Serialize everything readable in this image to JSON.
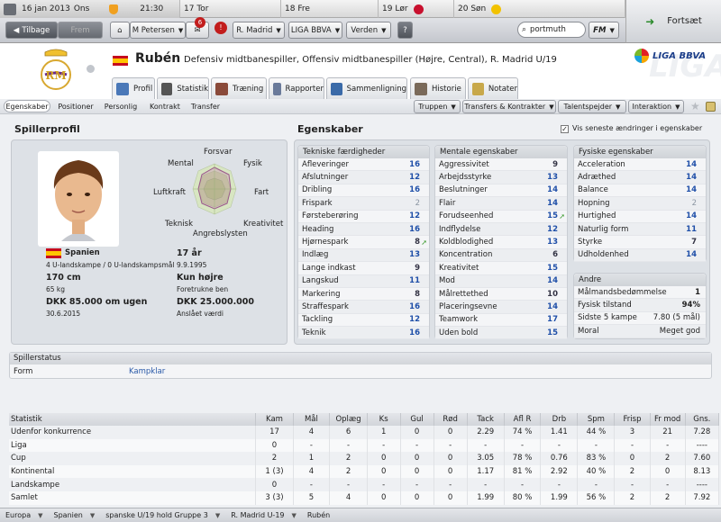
{
  "calendar": {
    "current_date": "16 jan 2013",
    "current_day": "Ons",
    "current_time": "21:30",
    "days": [
      {
        "label": "17 Tor",
        "color": ""
      },
      {
        "label": "18 Fre",
        "color": ""
      },
      {
        "label": "19 Lør",
        "color": "#c8102e"
      },
      {
        "label": "20 Søn",
        "color": "#f2c200"
      }
    ]
  },
  "nav": {
    "back": "Tilbage",
    "forward": "Frem",
    "manager": "M Petersen",
    "notif_count_a": "6",
    "notif_count_b": "!",
    "club": "R. Madrid",
    "league": "LIGA BBVA",
    "world": "Verden",
    "help": "?",
    "search_value": "portmuth",
    "fm_label": "FM",
    "continue": "Fortsæt"
  },
  "player": {
    "name": "Rubén",
    "description": "Defensiv midtbanespiller, Offensiv midtbanespiller (Højre, Central), R. Madrid U/19",
    "league_logo": "LIGA BBVA",
    "flag_colors": [
      "#c60b1e",
      "#ffc400"
    ]
  },
  "tabs": [
    {
      "label": "Profil",
      "icon": "profile-icon",
      "color": "#4a78b8"
    },
    {
      "label": "Statistik",
      "icon": "stats-icon",
      "color": "#555"
    },
    {
      "label": "Træning",
      "icon": "training-icon",
      "color": "#8a4a3a"
    },
    {
      "label": "Rapporter",
      "icon": "reports-icon",
      "color": "#6a7a9a"
    },
    {
      "label": "Sammenligning",
      "icon": "compare-icon",
      "color": "#3a6aa8"
    },
    {
      "label": "Historie",
      "icon": "history-icon",
      "color": "#7a6a5a"
    },
    {
      "label": "Notater",
      "icon": "notes-icon",
      "color": "#c8a84a"
    }
  ],
  "subtabs": [
    "Egenskaber",
    "Positioner",
    "Personlig",
    "Kontrakt",
    "Transfer"
  ],
  "actions": [
    "Truppen",
    "Transfers & Kontrakter",
    "Talentspejder",
    "Interaktion"
  ],
  "profile": {
    "title": "Spillerprofil",
    "radar_labels": {
      "top": "Forsvar",
      "top_left": "Mental",
      "top_right": "Fysik",
      "left": "Luftkraft",
      "right": "Fart",
      "bottom_left": "Teknisk",
      "bottom_right": "Kreativitet",
      "bottom": "Angrebslysten"
    },
    "nationality": "Spanien",
    "caps": "4 U-landskampe / 0 U-landskampsmål",
    "age": "17 år",
    "dob": "9.9.1995",
    "height": "170 cm",
    "weight": "65 kg",
    "foot": "Kun højre",
    "foot_label": "Foretrukne ben",
    "wage": "DKK 85.000 om ugen",
    "contract_end": "30.6.2015",
    "value": "DKK 25.000.000",
    "value_label": "Anslået værdi"
  },
  "attributes": {
    "title": "Egenskaber",
    "checkbox_label": "Vis seneste ændringer i egenskaber",
    "technical": {
      "title": "Tekniske færdigheder",
      "items": [
        {
          "name": "Afleveringer",
          "value": 16
        },
        {
          "name": "Afslutninger",
          "value": 12
        },
        {
          "name": "Dribling",
          "value": 16
        },
        {
          "name": "Frispark",
          "value": 2
        },
        {
          "name": "Førsteberøring",
          "value": 12
        },
        {
          "name": "Heading",
          "value": 16
        },
        {
          "name": "Hjørnespark",
          "value": 8,
          "mark": "up"
        },
        {
          "name": "Indlæg",
          "value": 13
        },
        {
          "name": "Lange indkast",
          "value": 9
        },
        {
          "name": "Langskud",
          "value": 11
        },
        {
          "name": "Markering",
          "value": 8
        },
        {
          "name": "Straffespark",
          "value": 16
        },
        {
          "name": "Tackling",
          "value": 12
        },
        {
          "name": "Teknik",
          "value": 16
        }
      ]
    },
    "mental": {
      "title": "Mentale egenskaber",
      "items": [
        {
          "name": "Aggressivitet",
          "value": 9
        },
        {
          "name": "Arbejdsstyrke",
          "value": 13
        },
        {
          "name": "Beslutninger",
          "value": 14
        },
        {
          "name": "Flair",
          "value": 14
        },
        {
          "name": "Forudseenhed",
          "value": 15,
          "mark": "up"
        },
        {
          "name": "Indflydelse",
          "value": 12
        },
        {
          "name": "Koldblodighed",
          "value": 13
        },
        {
          "name": "Koncentration",
          "value": 6
        },
        {
          "name": "Kreativitet",
          "value": 15
        },
        {
          "name": "Mod",
          "value": 14
        },
        {
          "name": "Målrettethed",
          "value": 10
        },
        {
          "name": "Placeringsevne",
          "value": 14
        },
        {
          "name": "Teamwork",
          "value": 17
        },
        {
          "name": "Uden bold",
          "value": 15
        }
      ]
    },
    "physical": {
      "title": "Fysiske egenskaber",
      "items": [
        {
          "name": "Acceleration",
          "value": 14
        },
        {
          "name": "Adræthed",
          "value": 14
        },
        {
          "name": "Balance",
          "value": 14
        },
        {
          "name": "Hopning",
          "value": 2
        },
        {
          "name": "Hurtighed",
          "value": 14
        },
        {
          "name": "Naturlig form",
          "value": 11
        },
        {
          "name": "Styrke",
          "value": 7
        },
        {
          "name": "Udholdenhed",
          "value": 14
        }
      ]
    },
    "other": {
      "title": "Andre",
      "items": [
        {
          "name": "Målmandsbedømmelse",
          "value": "1"
        },
        {
          "name": "Fysisk tilstand",
          "value": "94%"
        },
        {
          "name": "Sidste 5 kampe",
          "value": "7.80 (5 mål)"
        },
        {
          "name": "Moral",
          "value": "Meget god"
        }
      ]
    }
  },
  "status": {
    "title": "Spillerstatus",
    "label": "Form",
    "value": "Kampklar"
  },
  "stats": {
    "headers": [
      "Statistik",
      "Kam",
      "Mål",
      "Oplæg",
      "Ks",
      "Gul",
      "Rød",
      "Tack",
      "Afl R",
      "Drb",
      "Spm",
      "Frisp",
      "Fr mod",
      "Gns."
    ],
    "rows": [
      [
        "Udenfor konkurrence",
        "17",
        "4",
        "6",
        "1",
        "0",
        "0",
        "2.29",
        "74 %",
        "1.41",
        "44 %",
        "3",
        "21",
        "7.28"
      ],
      [
        "Liga",
        "0",
        "-",
        "-",
        "-",
        "-",
        "-",
        "-",
        "-",
        "-",
        "-",
        "-",
        "-",
        "----"
      ],
      [
        "Cup",
        "2",
        "1",
        "2",
        "0",
        "0",
        "0",
        "3.05",
        "78 %",
        "0.76",
        "83 %",
        "0",
        "2",
        "7.60"
      ],
      [
        "Kontinental",
        "1 (3)",
        "4",
        "2",
        "0",
        "0",
        "0",
        "1.17",
        "81 %",
        "2.92",
        "40 %",
        "2",
        "0",
        "8.13"
      ],
      [
        "Landskampe",
        "0",
        "-",
        "-",
        "-",
        "-",
        "-",
        "-",
        "-",
        "-",
        "-",
        "-",
        "-",
        "----"
      ],
      [
        "Samlet",
        "3 (3)",
        "5",
        "4",
        "0",
        "0",
        "0",
        "1.99",
        "80 %",
        "1.99",
        "56 %",
        "2",
        "2",
        "7.92"
      ]
    ]
  },
  "breadcrumbs": [
    "Europa",
    "Spanien",
    "spanske U/19 hold Gruppe 3",
    "R. Madrid U-19",
    "Rubén"
  ]
}
